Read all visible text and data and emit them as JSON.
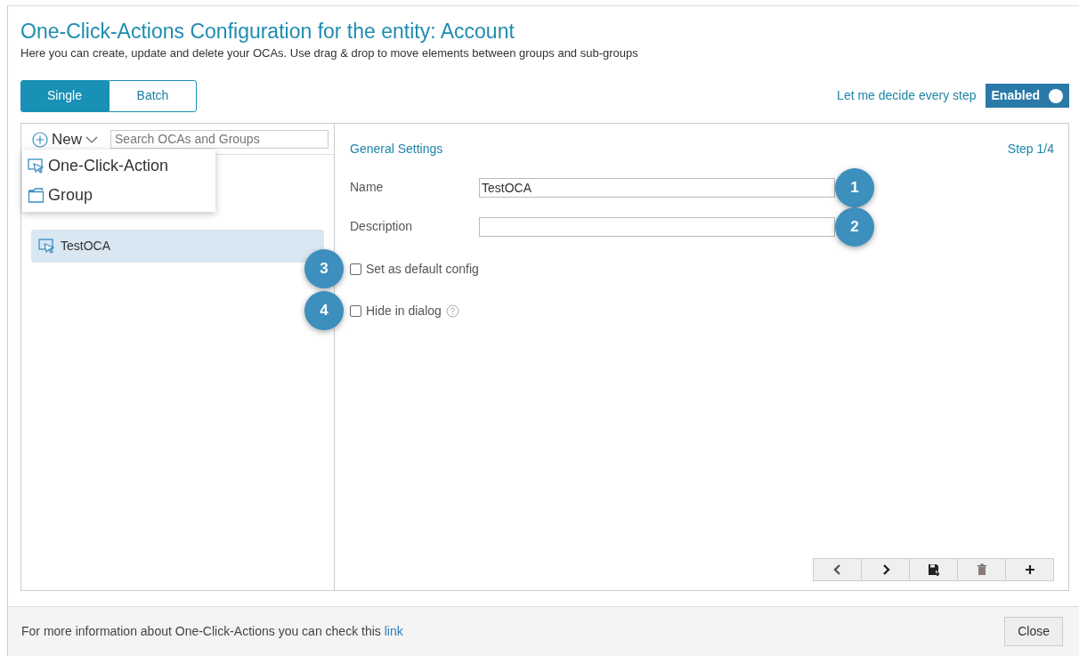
{
  "header": {
    "title": "One-Click-Actions Configuration for the entity: Account",
    "subtitle": "Here you can create, update and delete your OCAs. Use drag & drop to move elements between groups and sub-groups"
  },
  "mode_tabs": [
    {
      "label": "Single",
      "selected": true
    },
    {
      "label": "Batch",
      "selected": false
    }
  ],
  "step_toggle": {
    "label": "Let me decide every step",
    "state_text": "Enabled",
    "on": true
  },
  "sidebar": {
    "new_button": "New",
    "search": {
      "placeholder": "Search OCAs and Groups"
    },
    "new_menu": [
      {
        "label": "One-Click-Action",
        "kind": "action"
      },
      {
        "label": "Group",
        "kind": "group"
      }
    ],
    "items": [
      {
        "label": "TestOCA",
        "selected": true
      }
    ]
  },
  "form": {
    "section_title": "General Settings",
    "step": "Step 1/4",
    "fields": [
      {
        "label": "Name",
        "value": "TestOCA",
        "callout": "1"
      },
      {
        "label": "Description",
        "callout": "2"
      }
    ],
    "checkboxes": [
      {
        "label": "Set as default config",
        "checked": false,
        "help": false,
        "callout": "3"
      },
      {
        "label": "Hide in dialog",
        "checked": false,
        "help": true,
        "callout": "4"
      }
    ],
    "toolbar": [
      {
        "kind": "prev"
      },
      {
        "kind": "next"
      },
      {
        "kind": "save"
      },
      {
        "kind": "delete"
      },
      {
        "kind": "add"
      }
    ]
  },
  "footer": {
    "text": "For more information about One-Click-Actions you can check this",
    "link": "link",
    "close_button": "Close"
  }
}
